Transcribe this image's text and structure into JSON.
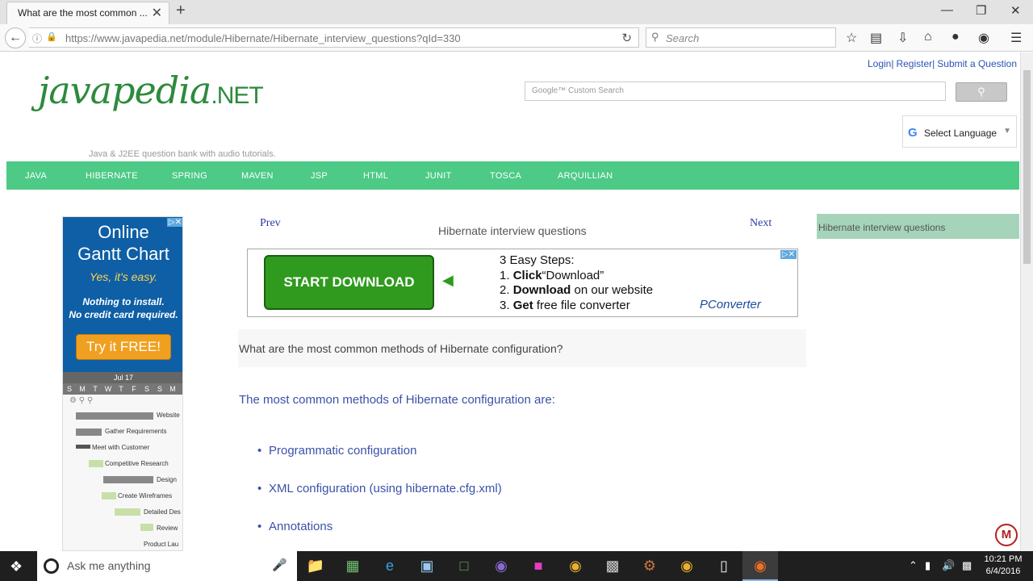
{
  "browser": {
    "tab_title": "What are the most common ...",
    "tab_close": "✕",
    "new_tab": "+",
    "url": "https://www.javapedia.net/module/Hibernate/Hibernate_interview_questions?qId=330",
    "search_placeholder": "Search",
    "win_minimize": "—",
    "win_restore": "❐",
    "win_close": "✕"
  },
  "site": {
    "logo_main": "javapedia",
    "logo_suffix": ".NET",
    "tagline": "Java & J2EE question bank with audio tutorials.",
    "top_links": [
      "Login|",
      "Register|",
      "Submit a Question"
    ],
    "google_search_placeholder": "Google™ Custom Search",
    "search_button_icon": "search-icon",
    "translate_label": "Select Language",
    "nav": [
      "JAVA",
      "HIBERNATE",
      "SPRING",
      "MAVEN",
      "JSP",
      "HTML",
      "JUNIT",
      "TOSCA",
      "ARQUILLIAN"
    ]
  },
  "left_ad": {
    "line1": "Online",
    "line2": "Gantt Chart",
    "sub": "Yes, it's easy.",
    "small1": "Nothing to install.",
    "small2": "No credit card required.",
    "cta": "Try it FREE!",
    "month": "Jul 17",
    "days": [
      "S",
      "M",
      "T",
      "W",
      "T",
      "F",
      "S",
      "S",
      "M"
    ],
    "tasks": [
      "Website",
      "Gather Requirements",
      "Meet with Customer",
      "Competitive Research",
      "Design",
      "Create Wireframes",
      "Detailed Des",
      "Review",
      "Product Lau"
    ]
  },
  "content": {
    "prev": "Prev",
    "next": "Next",
    "title": "Hibernate interview questions",
    "question": "What are the most common methods of Hibernate configuration?",
    "answer_intro": "The most common methods of Hibernate configuration are:",
    "bullets": [
      "Programmatic configuration",
      "XML configuration (using hibernate.cfg.xml)",
      "Annotations"
    ]
  },
  "mid_ad": {
    "button": "START DOWNLOAD",
    "step_heading": "3 Easy Steps:",
    "step1_bold": "Click",
    "step1_rest": "“Download”",
    "step2_bold": "Download",
    "step2_rest": "on our website",
    "step3_bold": "Get",
    "step3_rest": "free file converter",
    "brand": "PConverter"
  },
  "sidebar": {
    "item": "Hibernate interview questions"
  },
  "taskbar": {
    "cortana_placeholder": "Ask me anything",
    "time": "10:21 PM",
    "date": "6/4/2016"
  },
  "colors": {
    "nav_green": "#4cca86",
    "link_blue": "#3a52a8",
    "logo_green": "#2d8a3d",
    "sidebar_green": "#a6d4ba"
  }
}
